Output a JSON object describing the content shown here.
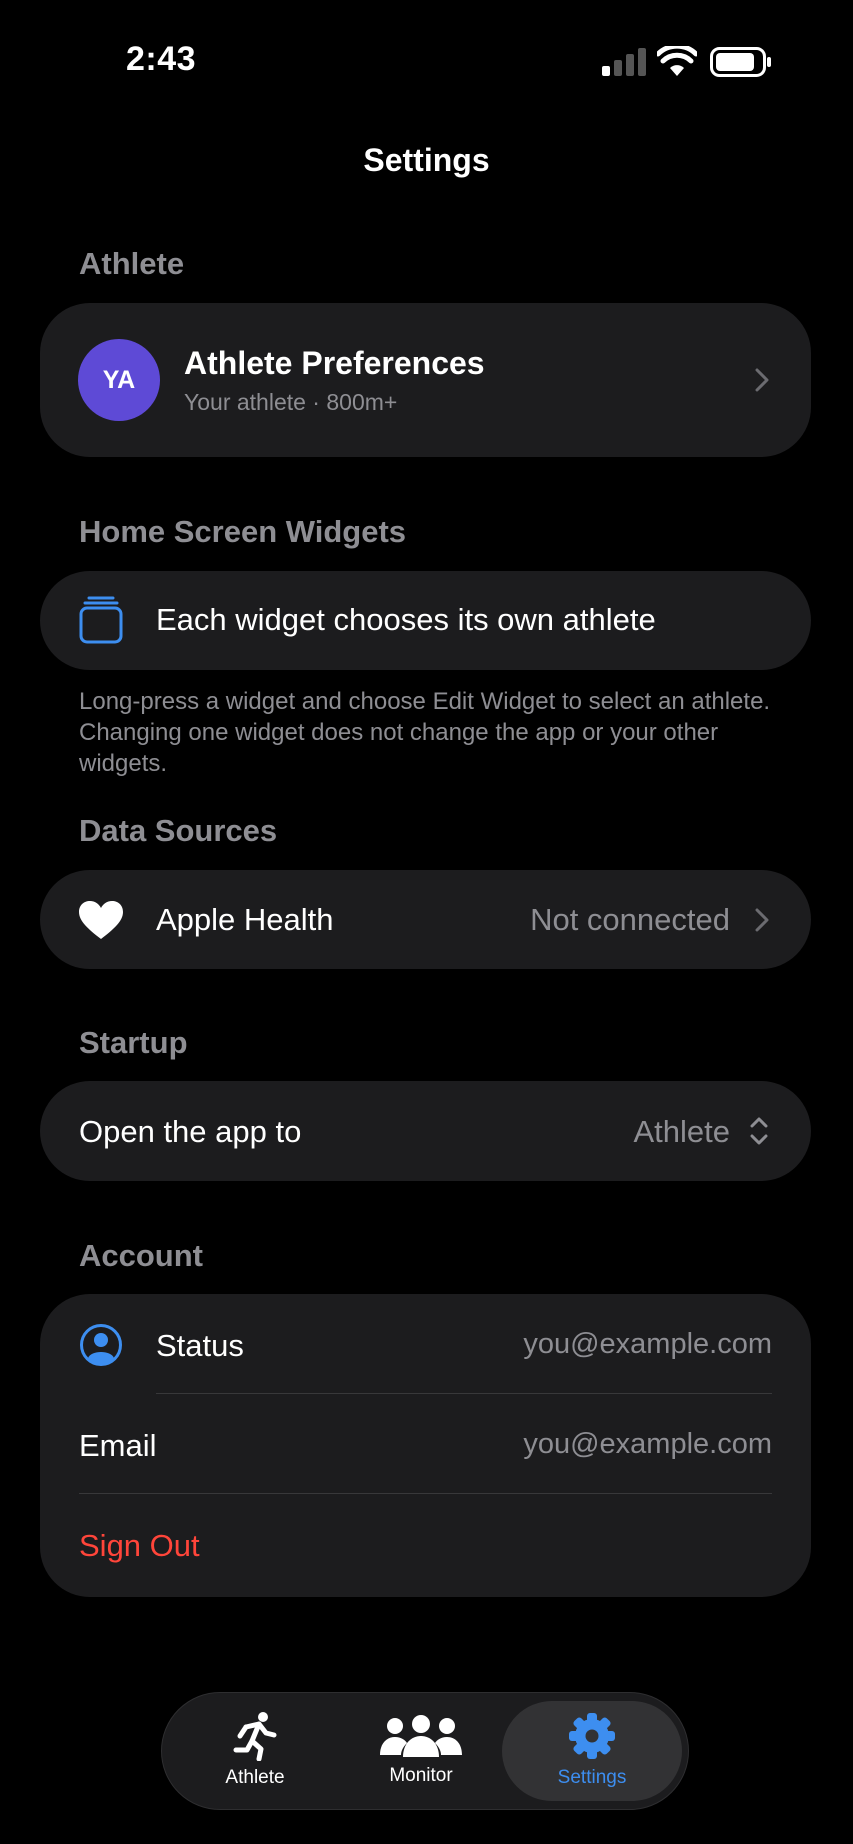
{
  "status_bar": {
    "time": "2:43"
  },
  "nav": {
    "title": "Settings"
  },
  "sections": {
    "athlete": {
      "header": "Athlete",
      "avatar_initials": "YA",
      "title": "Athlete Preferences",
      "subtitle": "Your athlete · 800m+"
    },
    "widgets": {
      "header": "Home Screen Widgets",
      "row_label": "Each widget chooses its own athlete",
      "footer": "Long-press a widget and choose Edit Widget to select an athlete. Changing one widget does not change the app or your other widgets."
    },
    "data_sources": {
      "header": "Data Sources",
      "label": "Apple Health",
      "value": "Not connected"
    },
    "startup": {
      "header": "Startup",
      "label": "Open the app to",
      "value": "Athlete"
    },
    "account": {
      "header": "Account",
      "status_label": "Status",
      "status_value": "you@example.com",
      "email_label": "Email",
      "email_value": "you@example.com",
      "sign_out": "Sign Out"
    }
  },
  "tabbar": {
    "tabs": [
      {
        "label": "Athlete",
        "icon": "runner-icon",
        "selected": false
      },
      {
        "label": "Monitor",
        "icon": "group-icon",
        "selected": false
      },
      {
        "label": "Settings",
        "icon": "gear-icon",
        "selected": true
      }
    ]
  },
  "colors": {
    "background": "#000000",
    "card": "#1c1c1e",
    "secondary_text": "#8e8e93",
    "accent_blue": "#3d8ef0",
    "avatar_purple": "#5e4ad6",
    "destructive_red": "#ff453a"
  }
}
